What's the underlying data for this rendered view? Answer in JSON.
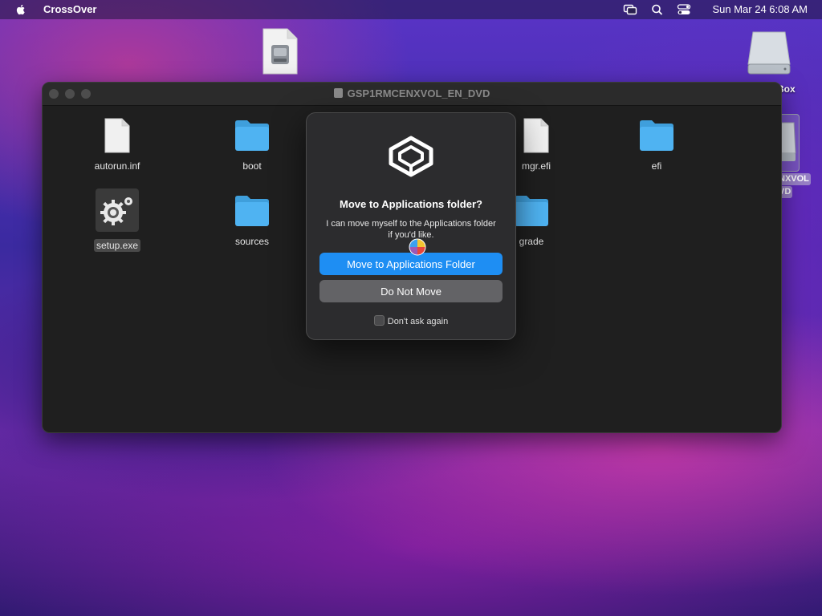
{
  "menubar": {
    "app_name": "CrossOver",
    "clock": "Sun Mar 24  6:08 AM",
    "icons": [
      "apple-logo-icon",
      "screen-mirroring-icon",
      "search-icon",
      "control-center-icon"
    ]
  },
  "desktop": {
    "drive_label_partial": "Box",
    "dvd_label_line1": "NXVOL",
    "dvd_label_line2": "VD"
  },
  "finder": {
    "title": "GSP1RMCENXVOL_EN_DVD",
    "items": [
      {
        "label": "autorun.inf",
        "icon": "document-icon"
      },
      {
        "label": "boot",
        "icon": "folder-icon"
      },
      {
        "label": "mgr.efi",
        "icon": "document-icon"
      },
      {
        "label": "efi",
        "icon": "folder-icon"
      },
      {
        "label": "setup.exe",
        "icon": "setup-gear-icon"
      },
      {
        "label": "sources",
        "icon": "folder-icon"
      },
      {
        "label": "grade",
        "icon": "folder-icon"
      }
    ]
  },
  "dialog": {
    "title": "Move to Applications folder?",
    "message": "I can move myself to the Applications folder if you'd like.",
    "primary_button": "Move to Applications Folder",
    "secondary_button": "Do Not Move",
    "checkbox_label": "Don't ask again",
    "checkbox_checked": false
  },
  "colors": {
    "accent": "#1e8ef3",
    "folder": "#4fb3f2"
  }
}
